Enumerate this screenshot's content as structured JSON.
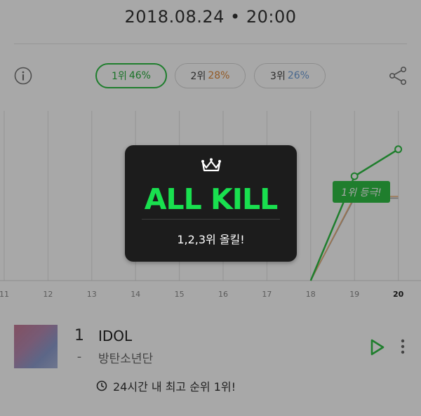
{
  "header": {
    "timestamp": "2018.08.24 • 20:00"
  },
  "rank_tabs": [
    {
      "label": "1위",
      "pct": "46%",
      "pct_color": "#27ad3c"
    },
    {
      "label": "2위",
      "pct": "28%",
      "pct_color": "#e08a3c"
    },
    {
      "label": "3위",
      "pct": "26%",
      "pct_color": "#6f9fd8"
    }
  ],
  "chart": {
    "x_ticks": [
      "11",
      "12",
      "13",
      "14",
      "15",
      "16",
      "17",
      "18",
      "19",
      "20"
    ],
    "x_highlight": "20",
    "badge": "1위 등극!",
    "series": [
      {
        "rank": "1위",
        "color": "#2fbf45",
        "values": [
          null,
          null,
          null,
          null,
          null,
          null,
          null,
          0,
          0.62,
          0.78
        ]
      },
      {
        "rank": "2위",
        "color": "#f0b27a",
        "values": [
          null,
          null,
          null,
          null,
          null,
          null,
          null,
          0,
          0.5,
          0.5
        ]
      },
      {
        "rank": "3위",
        "color": "#aaaaaa",
        "values": [
          null,
          null,
          null,
          null,
          null,
          null,
          null,
          0,
          0.49,
          0.49
        ]
      }
    ]
  },
  "modal": {
    "title": "ALL KILL",
    "subtitle": "1,2,3위 올킬!"
  },
  "song": {
    "rank": "1",
    "change": "-",
    "title": "IDOL",
    "artist": "방탄소년단"
  },
  "best_rank_text": "24시간 내 최고 순위 1위!",
  "colors": {
    "accent": "#2fbf45",
    "modal_bg": "#1c1c1c",
    "allkill_green": "#19e04f"
  },
  "icons": {
    "info": "info-icon",
    "share": "share-icon",
    "crown": "crown-icon",
    "play": "play-icon",
    "more": "more-vertical-icon",
    "clock": "clock-icon"
  }
}
